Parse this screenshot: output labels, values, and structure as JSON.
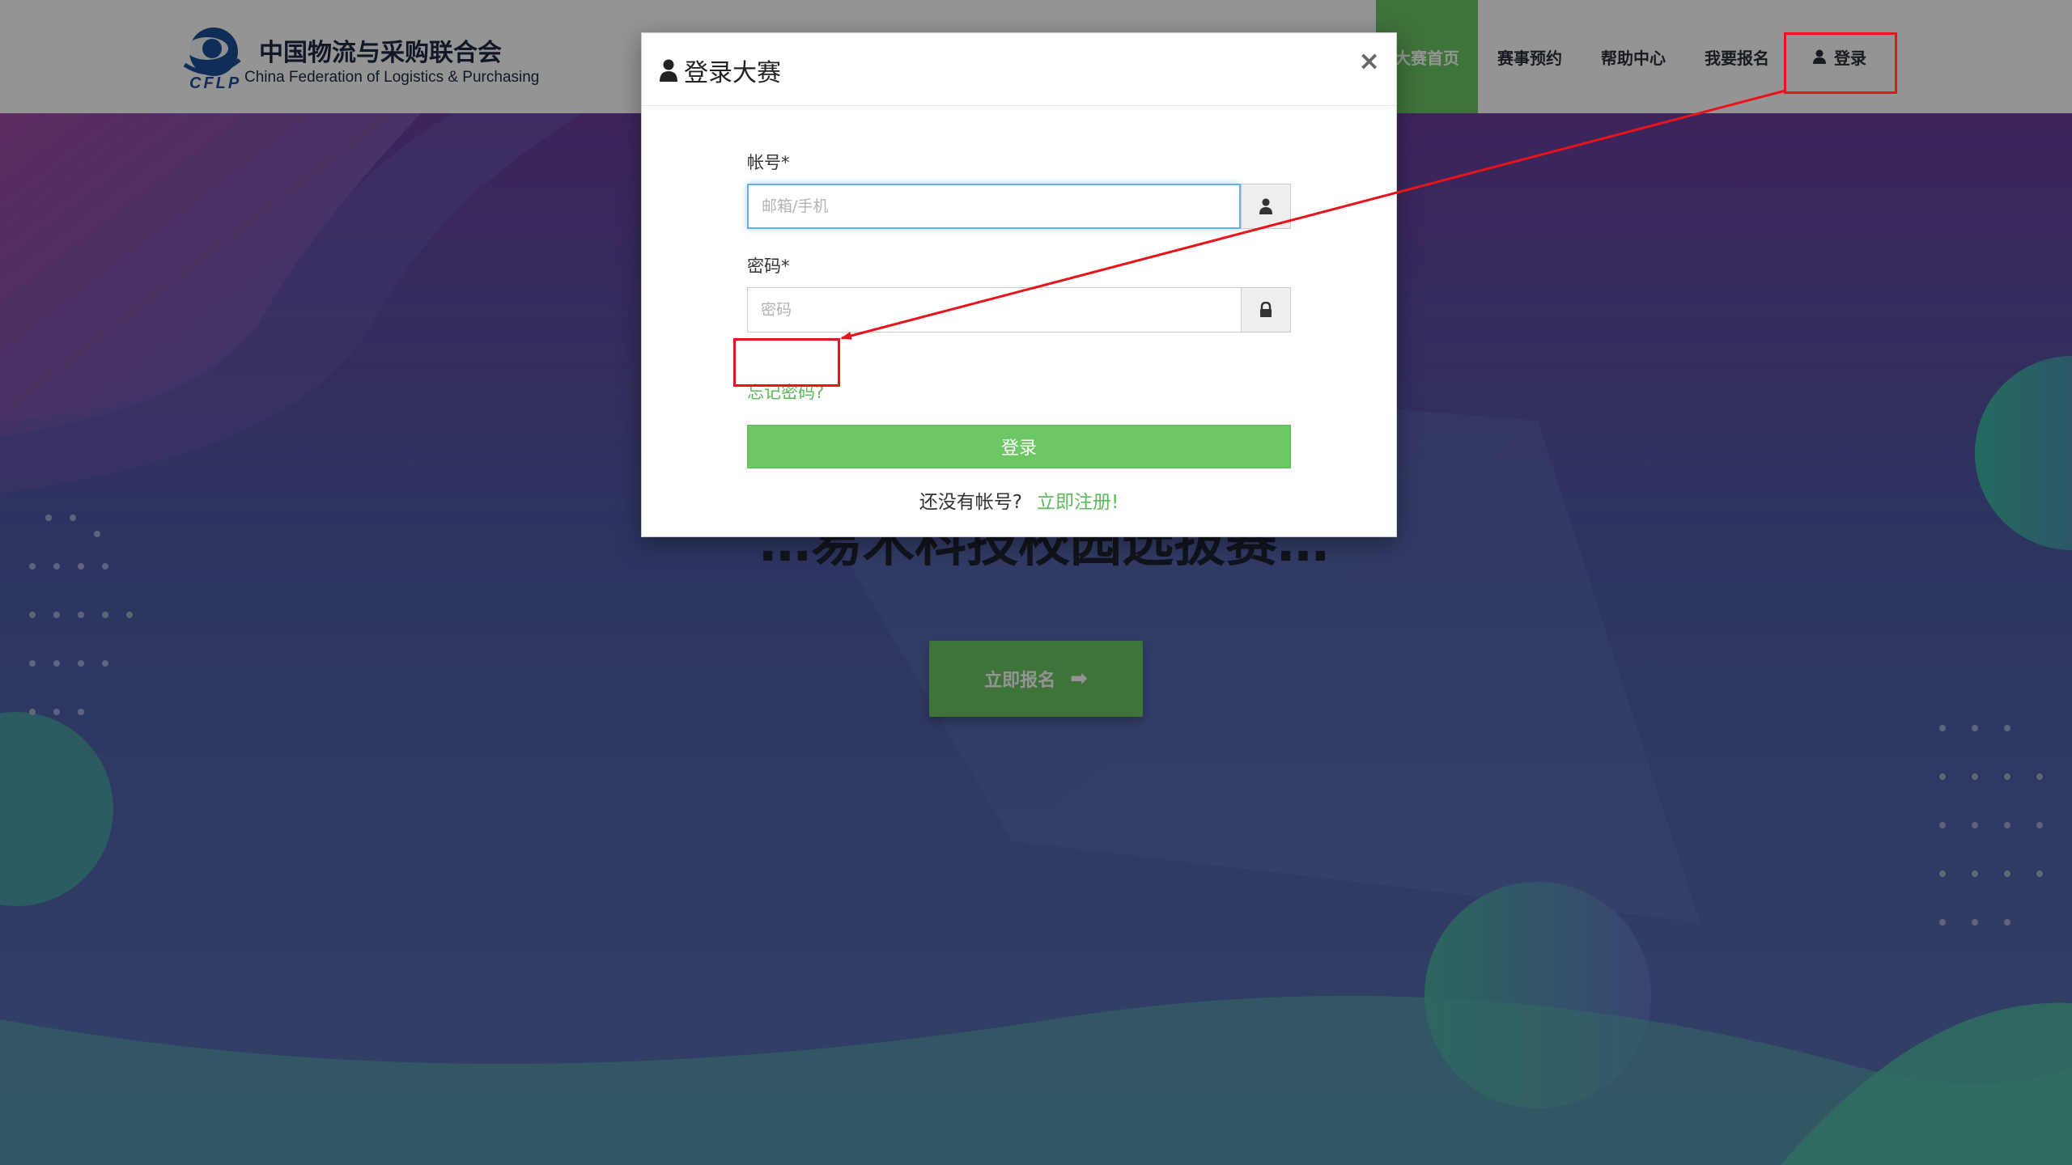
{
  "header": {
    "logo": {
      "name_cn": "中国物流与采购联合会",
      "name_en": "China Federation of Logistics & Purchasing",
      "abbr": "CFLP"
    },
    "nav": {
      "home": "大赛首页",
      "booking": "赛事预约",
      "help": "帮助中心",
      "signup": "我要报名",
      "login": "登录"
    }
  },
  "hero": {
    "title": "…易木科技校园选拔赛…",
    "cta": "立即报名",
    "cta_icon": "arrow-right-icon"
  },
  "login_modal": {
    "title": "登录大赛",
    "title_icon": "user-icon",
    "close": "×",
    "account_label": "帐号*",
    "account_placeholder": "邮箱/手机",
    "account_icon": "user-icon",
    "password_label": "密码*",
    "password_placeholder": "密码",
    "password_icon": "lock-icon",
    "forgot": "忘记密码?",
    "submit": "登录",
    "no_account_text": "还没有帐号?",
    "register_link": "立即注册!"
  },
  "colors": {
    "brand_green": "#6cc764",
    "link_green": "#5cb85c",
    "annotation_red": "#e8131b",
    "focus_blue": "#66afe9"
  }
}
